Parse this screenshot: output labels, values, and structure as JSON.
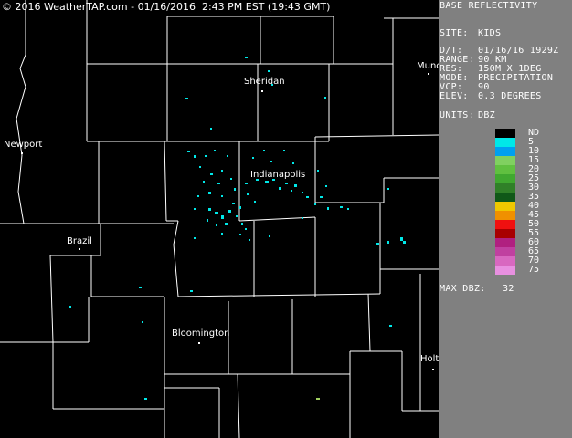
{
  "copyright": "© 2016 WeatherTAP.com - 01/16/2016  2:43 PM EST (19:43 GMT)",
  "panel": {
    "title": "BASE REFLECTIVITY",
    "site_label": "SITE:",
    "site_value": "KIDS",
    "dt_label": "D/T:",
    "dt_value": "01/16/16 1929Z",
    "range_label": "RANGE:",
    "range_value": "90 KM",
    "res_label": "RES:",
    "res_value": "150M X 1DEG",
    "mode_label": "MODE:",
    "mode_value": "PRECIPITATION",
    "vcp_label": "VCP:",
    "vcp_value": "90",
    "elev_label": "ELEV:",
    "elev_value": "0.3 DEGREES",
    "units_label": "UNITS:",
    "units_value": "DBZ",
    "maxdbz_label": "MAX DBZ:",
    "maxdbz_value": "32"
  },
  "legend": [
    {
      "label": "ND",
      "color": "#000000"
    },
    {
      "label": "5",
      "color": "#00e8e8"
    },
    {
      "label": "10",
      "color": "#00a0f0"
    },
    {
      "label": "15",
      "color": "#80d060"
    },
    {
      "label": "20",
      "color": "#60c040"
    },
    {
      "label": "25",
      "color": "#40a830"
    },
    {
      "label": "30",
      "color": "#308028"
    },
    {
      "label": "35",
      "color": "#105818"
    },
    {
      "label": "40",
      "color": "#f0c800"
    },
    {
      "label": "45",
      "color": "#f09000"
    },
    {
      "label": "50",
      "color": "#f01010"
    },
    {
      "label": "55",
      "color": "#a80000"
    },
    {
      "label": "60",
      "color": "#b02080"
    },
    {
      "label": "65",
      "color": "#c040a0"
    },
    {
      "label": "70",
      "color": "#d868c0"
    },
    {
      "label": "75",
      "color": "#e890e0"
    }
  ],
  "cities": {
    "sheridan": "Sheridan",
    "muncie": "Munc",
    "newport": "Newport",
    "indianapolis": "Indianapolis",
    "brazil": "Brazil",
    "bloomington": "Bloomington",
    "holton": "Holt"
  }
}
